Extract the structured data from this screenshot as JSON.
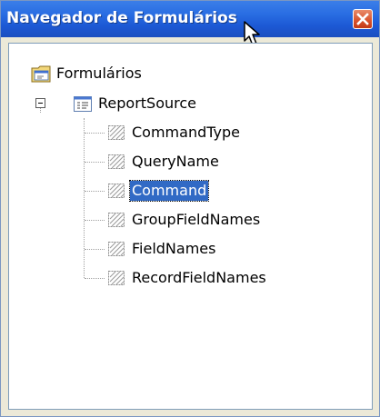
{
  "window": {
    "title": "Navegador de Formulários",
    "close_icon": "close-icon"
  },
  "tree": {
    "root": {
      "label": "Formulários",
      "icon": "forms-folder-icon"
    },
    "form": {
      "label": "ReportSource",
      "icon": "form-icon",
      "expanded": true
    },
    "controls": [
      {
        "label": "CommandType",
        "icon": "hidden-control-icon",
        "selected": false
      },
      {
        "label": "QueryName",
        "icon": "hidden-control-icon",
        "selected": false
      },
      {
        "label": "Command",
        "icon": "hidden-control-icon",
        "selected": true
      },
      {
        "label": "GroupFieldNames",
        "icon": "hidden-control-icon",
        "selected": false
      },
      {
        "label": "FieldNames",
        "icon": "hidden-control-icon",
        "selected": false
      },
      {
        "label": "RecordFieldNames",
        "icon": "hidden-control-icon",
        "selected": false
      }
    ]
  },
  "colors": {
    "title_bar": "#2a6ee3",
    "selection": "#316ac5",
    "close_button": "#d8512b"
  }
}
